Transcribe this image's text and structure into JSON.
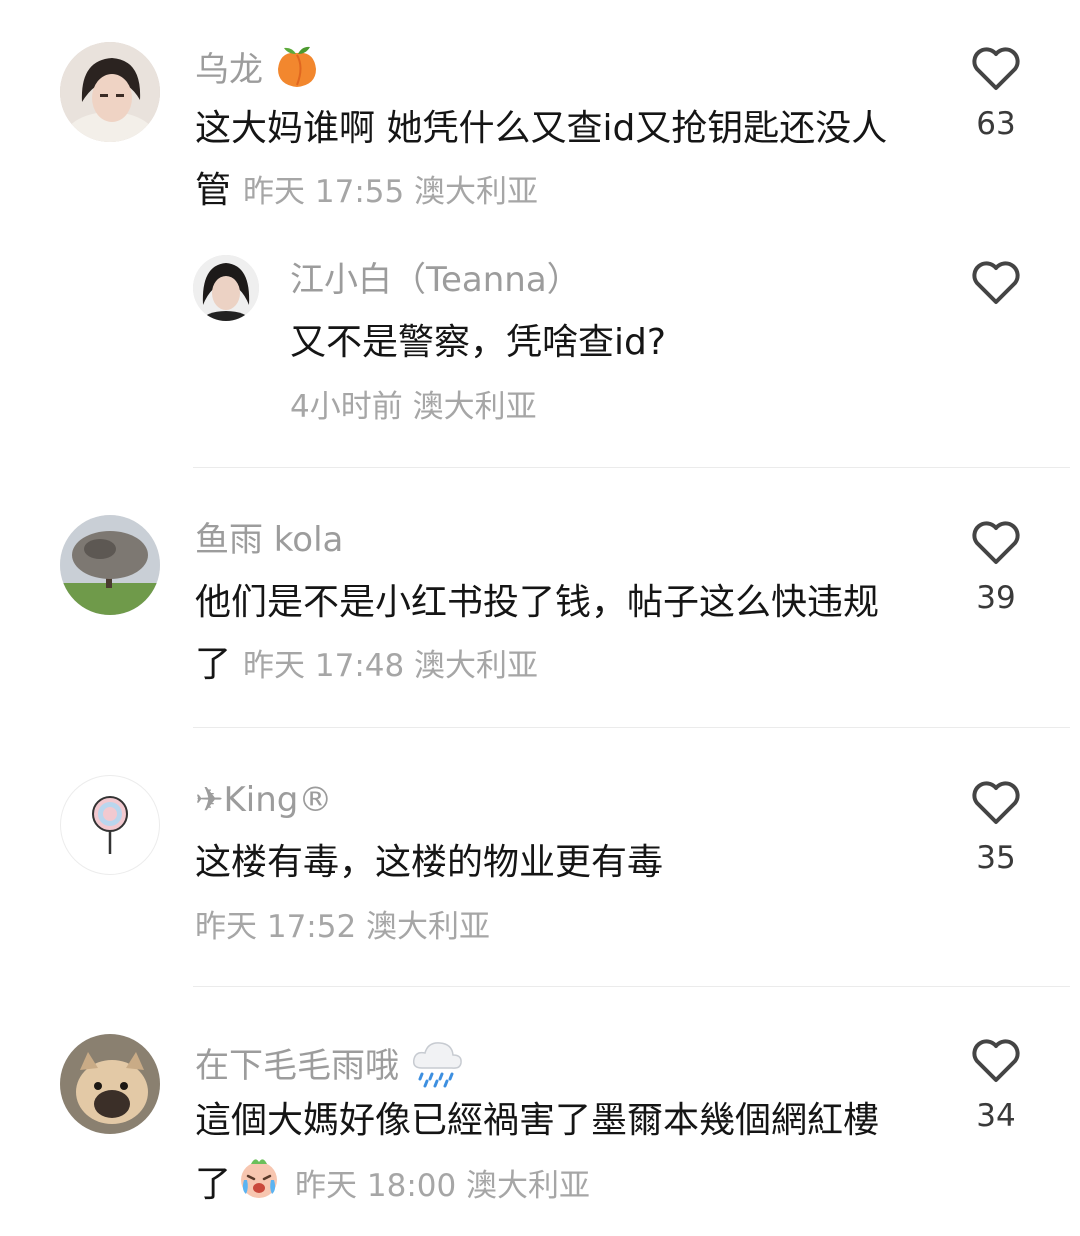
{
  "comments": [
    {
      "name": "乌龙",
      "name_emoji": "peach-icon",
      "text": "这大妈谁啊 她凭什么又查id又抢钥匙还没人管",
      "meta": "昨天 17:55 澳大利亚",
      "likes": "63",
      "reply": {
        "name": "江小白（Teanna）",
        "text": "又不是警察，凭啥查id?",
        "meta": "4小时前 澳大利亚"
      }
    },
    {
      "name": "鱼雨 kola",
      "text": "他们是不是小红书投了钱，帖子这么快违规了",
      "meta": "昨天 17:48 澳大利亚",
      "likes": "39"
    },
    {
      "name": "✈King®",
      "text": "这楼有毒，这楼的物业更有毒",
      "meta": "昨天 17:52 澳大利亚",
      "likes": "35"
    },
    {
      "name": "在下毛毛雨哦",
      "name_emoji": "rain-cloud-icon",
      "text": "這個大媽好像已經禍害了墨爾本幾個網紅樓了",
      "text_emoji": "crying-face-icon",
      "meta": "昨天 18:00 澳大利亚",
      "likes": "34"
    }
  ],
  "colors": {
    "name": "#9c9c9c",
    "text": "#151515",
    "meta": "#a6a6a6",
    "icon": "#444444"
  }
}
